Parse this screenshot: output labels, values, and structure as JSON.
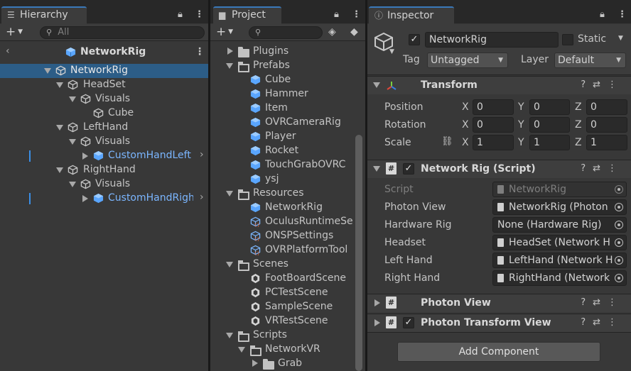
{
  "hierarchy": {
    "tab_label": "Hierarchy",
    "search_placeholder": "All",
    "scene_title": "NetworkRig",
    "items": [
      {
        "label": "NetworkRig"
      },
      {
        "label": "HeadSet"
      },
      {
        "label": "Visuals"
      },
      {
        "label": "Cube"
      },
      {
        "label": "LeftHand"
      },
      {
        "label": "Visuals"
      },
      {
        "label": "CustomHandLeft"
      },
      {
        "label": "RightHand"
      },
      {
        "label": "Visuals"
      },
      {
        "label": "CustomHandRight"
      }
    ]
  },
  "project": {
    "tab_label": "Project",
    "items": [
      {
        "label": "Plugins"
      },
      {
        "label": "Prefabs"
      },
      {
        "label": "Cube"
      },
      {
        "label": "Hammer"
      },
      {
        "label": "Item"
      },
      {
        "label": "OVRCameraRig"
      },
      {
        "label": "Player"
      },
      {
        "label": "Rocket"
      },
      {
        "label": "TouchGrabOVRC"
      },
      {
        "label": "ysj"
      },
      {
        "label": "Resources"
      },
      {
        "label": "NetworkRig"
      },
      {
        "label": "OculusRuntimeSe"
      },
      {
        "label": "ONSPSettings"
      },
      {
        "label": "OVRPlatformTool"
      },
      {
        "label": "Scenes"
      },
      {
        "label": "FootBoardScene"
      },
      {
        "label": "PCTestScene"
      },
      {
        "label": "SampleScene"
      },
      {
        "label": "VRTestScene"
      },
      {
        "label": "Scripts"
      },
      {
        "label": "NetworkVR"
      },
      {
        "label": "Grab"
      }
    ]
  },
  "inspector": {
    "tab_label": "Inspector",
    "object_name": "NetworkRig",
    "static_label": "Static",
    "tag_label": "Tag",
    "tag_value": "Untagged",
    "layer_label": "Layer",
    "layer_value": "Default",
    "transform": {
      "title": "Transform",
      "rows": [
        {
          "label": "Position",
          "x": "0",
          "y": "0",
          "z": "0"
        },
        {
          "label": "Rotation",
          "x": "0",
          "y": "0",
          "z": "0"
        },
        {
          "label": "Scale",
          "x": "1",
          "y": "1",
          "z": "1"
        }
      ],
      "axis_x": "X",
      "axis_y": "Y",
      "axis_z": "Z"
    },
    "network_rig": {
      "title": "Network Rig (Script)",
      "fields": [
        {
          "label": "Script",
          "value": "NetworkRig"
        },
        {
          "label": "Photon View",
          "value": "NetworkRig (Photon"
        },
        {
          "label": "Hardware Rig",
          "value": "None (Hardware Rig)"
        },
        {
          "label": "Headset",
          "value": "HeadSet (Network H"
        },
        {
          "label": "Left Hand",
          "value": "LeftHand (Network H"
        },
        {
          "label": "Right Hand",
          "value": "RightHand (Network"
        }
      ]
    },
    "photon_view_title": "Photon View",
    "photon_transform_view_title": "Photon Transform View",
    "add_component_label": "Add Component"
  },
  "colors": {
    "selection": "#2c5d87",
    "prefab_blue": "#7bb6ff",
    "panel_bg": "#383838"
  }
}
